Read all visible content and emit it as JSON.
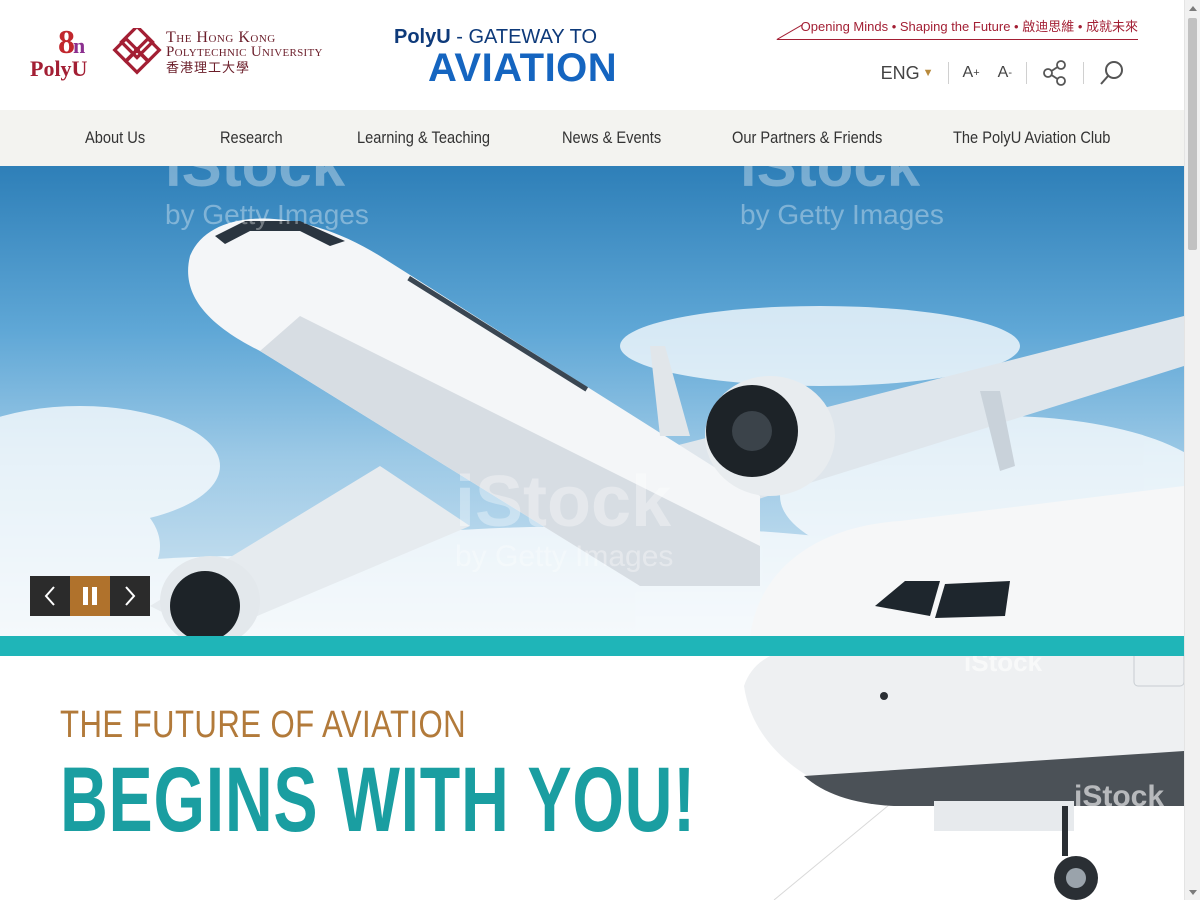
{
  "logos": {
    "polyu_mark_number": "8",
    "polyu_mark_suffix": "n",
    "polyu_mark_word": "PolyU",
    "university_name_line1": "The Hong Kong",
    "university_name_line2": "Polytechnic University",
    "university_name_chinese": "香港理工大學"
  },
  "site_title": {
    "prefix_bold": "PolyU",
    "prefix_rest": " - GATEWAY TO",
    "main": "AVIATION"
  },
  "slogan": "Opening Minds • Shaping the Future • 啟迪思維 • 成就未來",
  "tools": {
    "language": "ENG",
    "font_increase": "A",
    "font_increase_sup": "+",
    "font_decrease": "A",
    "font_decrease_sup": "-",
    "share_icon": "share-icon",
    "search_icon": "search-icon"
  },
  "nav": {
    "items": [
      {
        "label": "About Us"
      },
      {
        "label": "Research"
      },
      {
        "label": "Learning & Teaching"
      },
      {
        "label": "News & Events"
      },
      {
        "label": "Our Partners & Friends"
      },
      {
        "label": "The PolyU Aviation Club"
      }
    ]
  },
  "hero": {
    "watermark_main": "iStock",
    "watermark_sub": "by Getty Images",
    "controls": {
      "prev_icon": "chevron-left-icon",
      "pause_icon": "pause-icon",
      "next_icon": "chevron-right-icon"
    }
  },
  "tagline": {
    "line1": "THE FUTURE OF AVIATION",
    "line2": "BEGINS WITH YOU!"
  },
  "colors": {
    "brand_red": "#a31f34",
    "aviation_blue": "#1565c0",
    "teal": "#1a9ea1",
    "gold": "#b27a3a",
    "nav_bg": "#f3f3f0"
  }
}
